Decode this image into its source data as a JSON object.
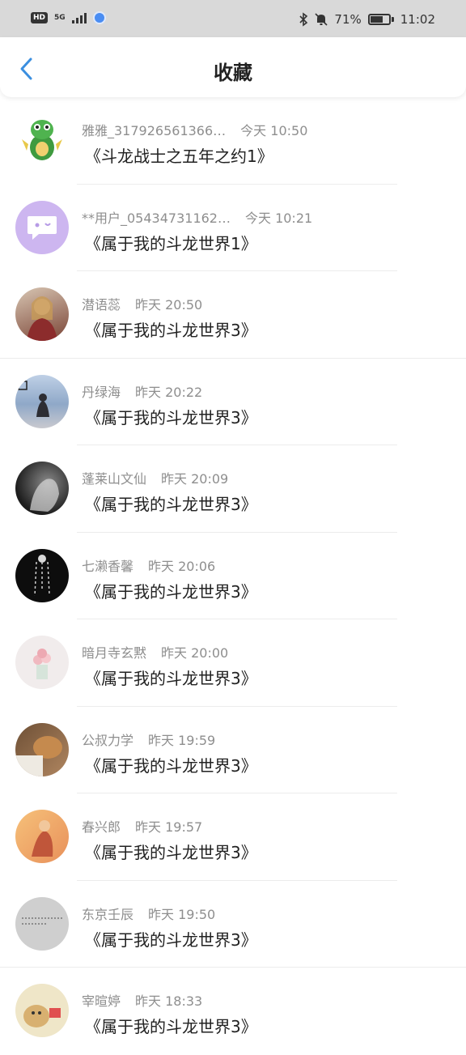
{
  "status_bar": {
    "hd": "HD",
    "network": "5G",
    "battery_percent": "71%",
    "time": "11:02",
    "icons": [
      "bluetooth-icon",
      "mute-icon",
      "battery-icon"
    ]
  },
  "header": {
    "title": "收藏",
    "back_icon": "chevron-left-icon"
  },
  "favorites": [
    {
      "user": "雅雅_317926561366…",
      "time": "今天 10:50",
      "book": "《斗龙战士之五年之约1》",
      "avatar_color": "#3f9a3f"
    },
    {
      "user": "**用户_05434731162…",
      "time": "今天 10:21",
      "book": "《属于我的斗龙世界1》",
      "avatar_color": "#cdb6f0"
    },
    {
      "user": "潜语蕊",
      "time": "昨天 20:50",
      "book": "《属于我的斗龙世界3》",
      "avatar_color": "#7a4436"
    },
    {
      "user": "丹绿海",
      "time": "昨天 20:22",
      "book": "《属于我的斗龙世界3》",
      "avatar_color": "#8fa8c8"
    },
    {
      "user": "蓬莱山文仙",
      "time": "昨天 20:09",
      "book": "《属于我的斗龙世界3》",
      "avatar_color": "#3a3a3a"
    },
    {
      "user": "七濑香馨",
      "time": "昨天 20:06",
      "book": "《属于我的斗龙世界3》",
      "avatar_color": "#0d0d0d"
    },
    {
      "user": "暗月寺玄黙",
      "time": "昨天 20:00",
      "book": "《属于我的斗龙世界3》",
      "avatar_color": "#e9dfe0"
    },
    {
      "user": "公叔力学",
      "time": "昨天 19:59",
      "book": "《属于我的斗龙世界3》",
      "avatar_color": "#8a6a48"
    },
    {
      "user": "春兴郎",
      "time": "昨天 19:57",
      "book": "《属于我的斗龙世界3》",
      "avatar_color": "#e8905a"
    },
    {
      "user": "东京壬辰",
      "time": "昨天 19:50",
      "book": "《属于我的斗龙世界3》",
      "avatar_color": "#cfcfcf"
    },
    {
      "user": "宰暄婷",
      "time": "昨天 18:33",
      "book": "《属于我的斗龙世界3》",
      "avatar_color": "#d8c590"
    }
  ],
  "colors": {
    "accent": "#3b8fe0",
    "text_primary": "#222222",
    "text_secondary": "#8e8e8e"
  }
}
